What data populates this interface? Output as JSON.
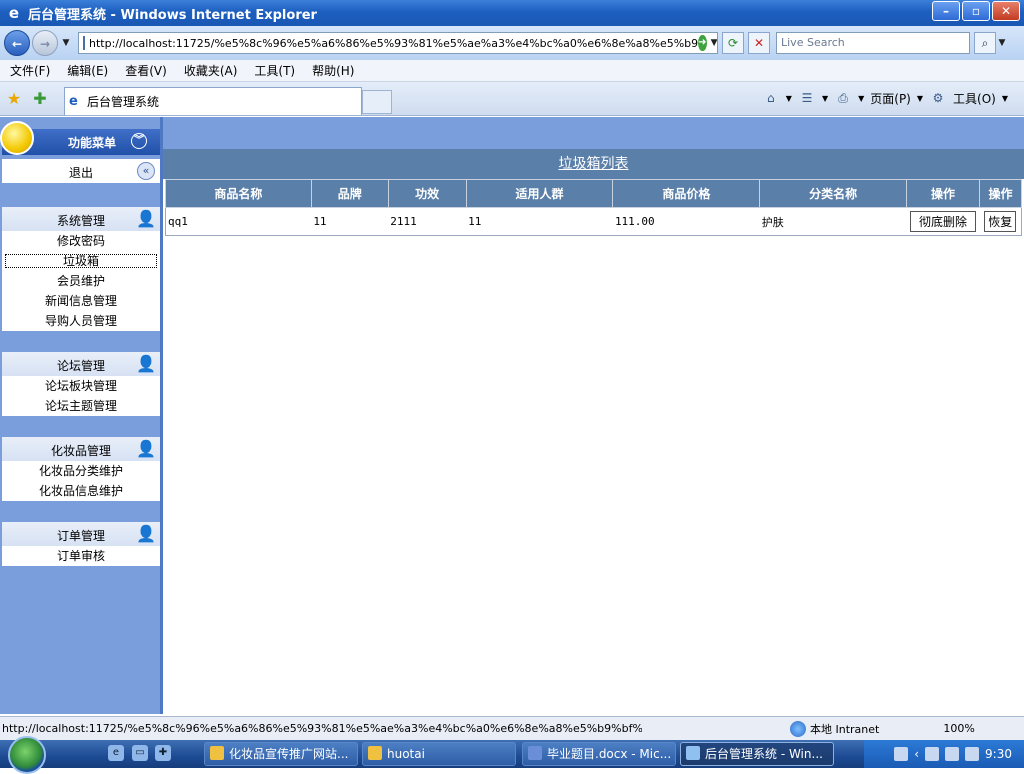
{
  "window": {
    "title": "后台管理系统 - Windows Internet Explorer"
  },
  "nav": {
    "address": "http://localhost:11725/%e5%8c%96%e5%a6%86%e5%93%81%e5%ae%a3%e4%bc%a0%e6%8e%a8%e5%b9",
    "search_placeholder": "Live Search"
  },
  "menu": [
    "文件(F)",
    "编辑(E)",
    "查看(V)",
    "收藏夹(A)",
    "工具(T)",
    "帮助(H)"
  ],
  "tab": {
    "title": "后台管理系统"
  },
  "tools": {
    "page": "页面(P)",
    "tools": "工具(O)"
  },
  "sidebar": {
    "title": "功能菜单",
    "logout": "退出",
    "groups": [
      {
        "title": "系统管理",
        "items": [
          "修改密码",
          "垃圾箱",
          "会员维护",
          "新闻信息管理",
          "导购人员管理"
        ]
      },
      {
        "title": "论坛管理",
        "items": [
          "论坛板块管理",
          "论坛主题管理"
        ]
      },
      {
        "title": "化妆品管理",
        "items": [
          "化妆品分类维护",
          "化妆品信息维护"
        ]
      },
      {
        "title": "订单管理",
        "items": [
          "订单审核"
        ]
      }
    ]
  },
  "main": {
    "list_title": "垃圾箱列表",
    "columns": [
      "商品名称",
      "品牌",
      "功效",
      "适用人群",
      "商品价格",
      "分类名称",
      "操作",
      "操作"
    ],
    "rows": [
      {
        "name": "qq1",
        "brand": "11",
        "effect": "2111",
        "audience": "11",
        "price": "111.00",
        "category": "护肤",
        "delete": "彻底删除",
        "restore": "恢复"
      }
    ]
  },
  "status": {
    "url": "http://localhost:11725/%e5%8c%96%e5%a6%86%e5%93%81%e5%ae%a3%e4%bc%a0%e6%8e%a8%e5%b9%bf%e7%bd%91%",
    "zone": "本地 Intranet",
    "zoom": "100%"
  },
  "taskbar": {
    "tasks": [
      "化妆品宣传推广网站...",
      "huotai",
      "毕业题目.docx - Mic...",
      "后台管理系统 - Win..."
    ],
    "clock": "9:30"
  }
}
